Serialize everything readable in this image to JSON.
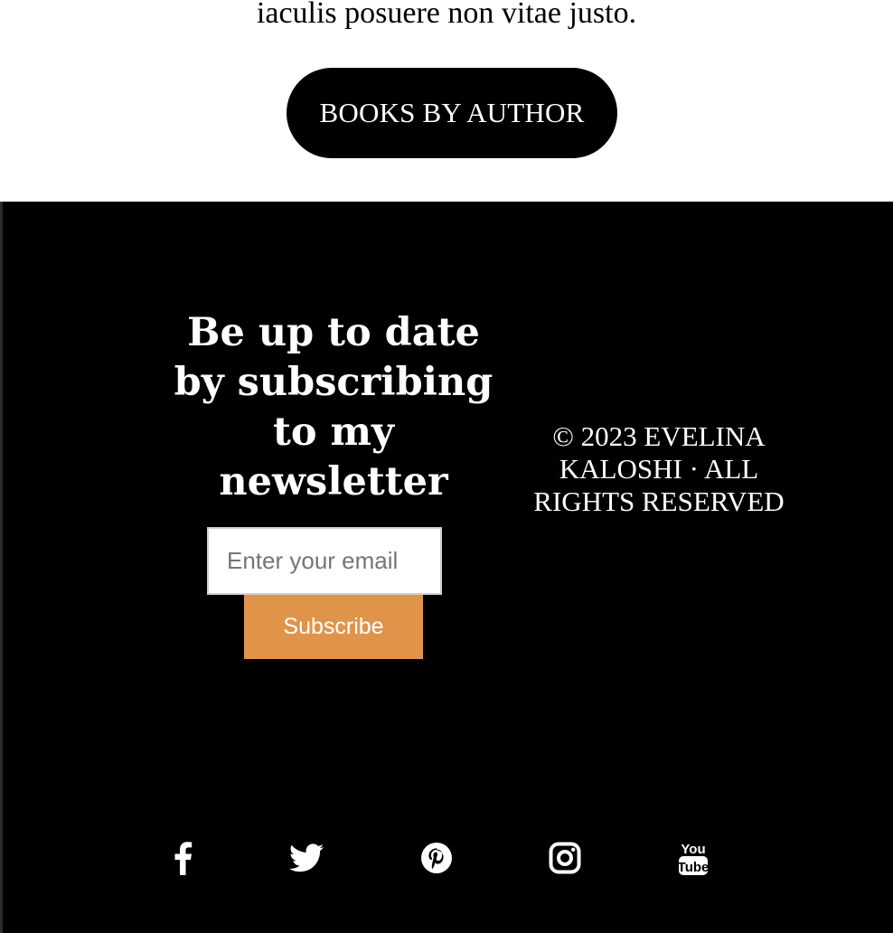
{
  "intro": {
    "text": "iaculis posuere non vitae justo."
  },
  "cta": {
    "label": "BOOKS BY AUTHOR"
  },
  "footer": {
    "newsletter": {
      "heading": "Be up to date by subscribing to my newsletter",
      "email_placeholder": "Enter your email",
      "email_value": "",
      "subscribe_label": "Subscribe"
    },
    "copyright": "© 2023 EVELINA KALOSHI · ALL RIGHTS RESERVED",
    "social": [
      {
        "icon": "facebook-icon"
      },
      {
        "icon": "twitter-icon"
      },
      {
        "icon": "pinterest-icon"
      },
      {
        "icon": "instagram-icon"
      },
      {
        "icon": "youtube-icon"
      }
    ]
  },
  "colors": {
    "footer_background": "#000000",
    "subscribe_button": "#e09449",
    "cta_background": "#000000",
    "text_on_dark": "#ffffff"
  }
}
